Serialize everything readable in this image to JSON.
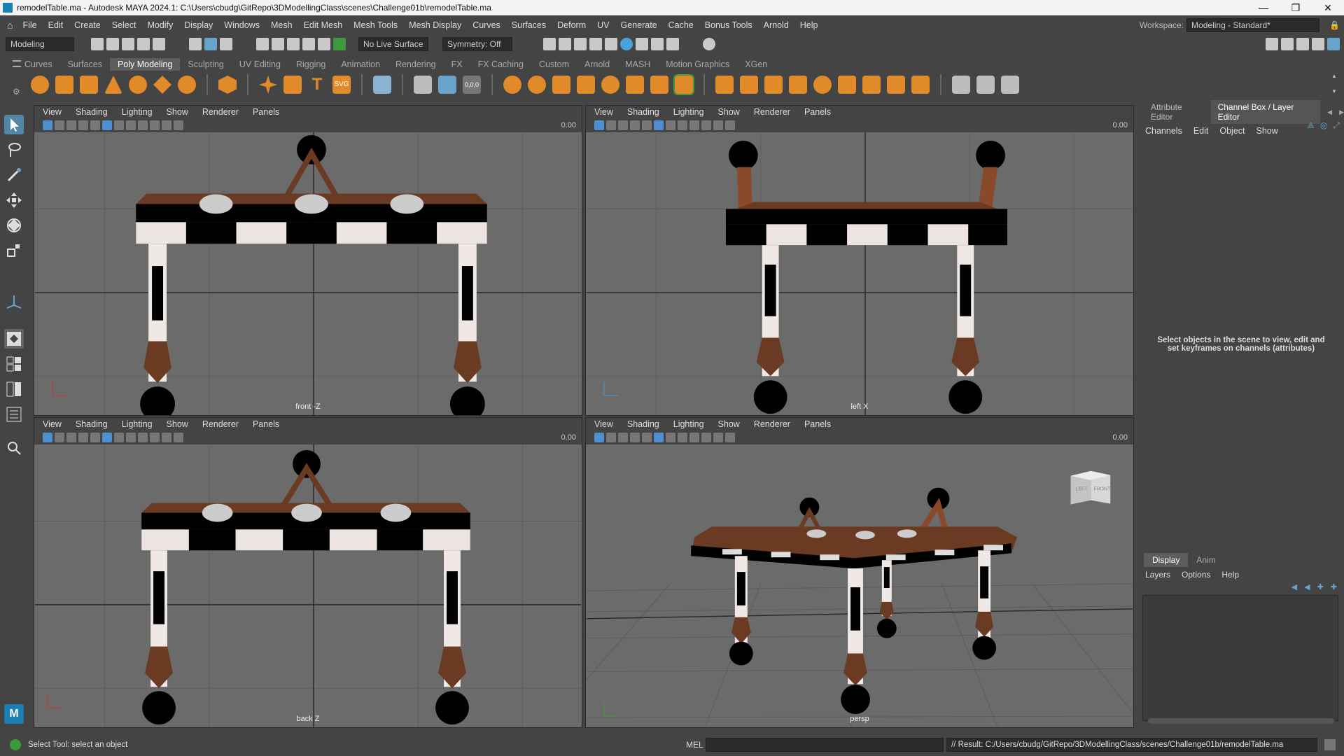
{
  "window": {
    "title": "remodelTable.ma - Autodesk MAYA 2024.1: C:\\Users\\cbudg\\GitRepo\\3DModellingClass\\scenes\\Challenge01b\\remodelTable.ma",
    "min": "—",
    "max": "❐",
    "close": "✕"
  },
  "menubar": {
    "items": [
      "File",
      "Edit",
      "Create",
      "Select",
      "Modify",
      "Display",
      "Windows",
      "Mesh",
      "Edit Mesh",
      "Mesh Tools",
      "Mesh Display",
      "Curves",
      "Surfaces",
      "Deform",
      "UV",
      "Generate",
      "Cache",
      "Bonus Tools",
      "Arnold",
      "Help"
    ],
    "workspace_label": "Workspace:",
    "workspace_value": "Modeling - Standard*"
  },
  "statusline": {
    "mode": "Modeling",
    "live_surface": "No Live Surface",
    "symmetry": "Symmetry: Off"
  },
  "shelf": {
    "tabs": [
      "Curves",
      "Surfaces",
      "Poly Modeling",
      "Sculpting",
      "UV Editing",
      "Rigging",
      "Animation",
      "Rendering",
      "FX",
      "FX Caching",
      "Custom",
      "Arnold",
      "MASH",
      "Motion Graphics",
      "XGen"
    ],
    "active_tab": "Poly Modeling",
    "svg_label": "SVG",
    "text_label": "T",
    "coord_label": "0,0,0"
  },
  "viewports": {
    "menu": [
      "View",
      "Shading",
      "Lighting",
      "Show",
      "Renderer",
      "Panels"
    ],
    "number": "0.00",
    "front": {
      "camera": "front -Z"
    },
    "left": {
      "camera": "left X"
    },
    "back": {
      "camera": "back Z"
    },
    "persp": {
      "camera": "persp"
    },
    "viewcube_left": "LEFT",
    "viewcube_front": "FRONT"
  },
  "rightpanel": {
    "tabs": [
      "Attribute Editor",
      "Channel Box / Layer Editor"
    ],
    "active_tab": "Channel Box / Layer Editor",
    "submenu": [
      "Channels",
      "Edit",
      "Object",
      "Show"
    ],
    "message": "Select objects in the scene to view, edit and set keyframes on channels (attributes)",
    "layer_tabs": [
      "Display",
      "Anim"
    ],
    "layer_active": "Display",
    "layer_menu": [
      "Layers",
      "Options",
      "Help"
    ]
  },
  "bottombar": {
    "help_text": "Select Tool: select an object",
    "mel_label": "MEL",
    "result": "// Result: C:/Users/cbudg/GitRepo/3DModellingClass/scenes/Challenge01b/remodelTable.ma"
  },
  "colors": {
    "viewport_bg": "#6b6b6b",
    "wood": "#6a3a22",
    "highlight_blue": "#5285a6",
    "shelf_orange": "#e08a2a"
  }
}
